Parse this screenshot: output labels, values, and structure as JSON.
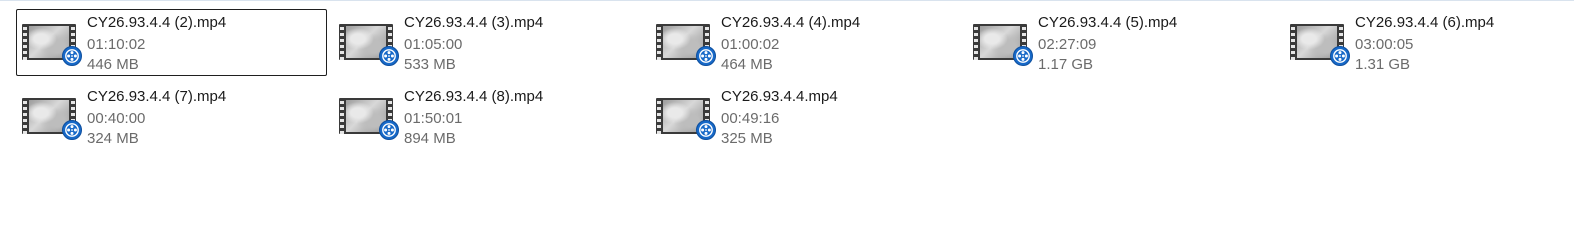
{
  "files": [
    {
      "name": "CY26.93.4.4 (2).mp4",
      "duration": "01:10:02",
      "size": "446 MB",
      "selected": true,
      "icon": "video-file-icon"
    },
    {
      "name": "CY26.93.4.4 (3).mp4",
      "duration": "01:05:00",
      "size": "533 MB",
      "selected": false,
      "icon": "video-file-icon"
    },
    {
      "name": "CY26.93.4.4 (4).mp4",
      "duration": "01:00:02",
      "size": "464 MB",
      "selected": false,
      "icon": "video-file-icon"
    },
    {
      "name": "CY26.93.4.4 (5).mp4",
      "duration": "02:27:09",
      "size": "1.17 GB",
      "selected": false,
      "icon": "video-file-icon"
    },
    {
      "name": "CY26.93.4.4 (6).mp4",
      "duration": "03:00:05",
      "size": "1.31 GB",
      "selected": false,
      "icon": "video-file-icon"
    },
    {
      "name": "CY26.93.4.4 (7).mp4",
      "duration": "00:40:00",
      "size": "324 MB",
      "selected": false,
      "icon": "video-file-icon"
    },
    {
      "name": "CY26.93.4.4 (8).mp4",
      "duration": "01:50:01",
      "size": "894 MB",
      "selected": false,
      "icon": "video-file-icon"
    },
    {
      "name": "CY26.93.4.4.mp4",
      "duration": "00:49:16",
      "size": "325 MB",
      "selected": false,
      "icon": "video-file-icon"
    }
  ],
  "colors": {
    "badge": "#1769c8",
    "name_text": "#1a1a1a",
    "meta_text": "#6b6b6b",
    "selection_border": "#1f1f1f"
  }
}
